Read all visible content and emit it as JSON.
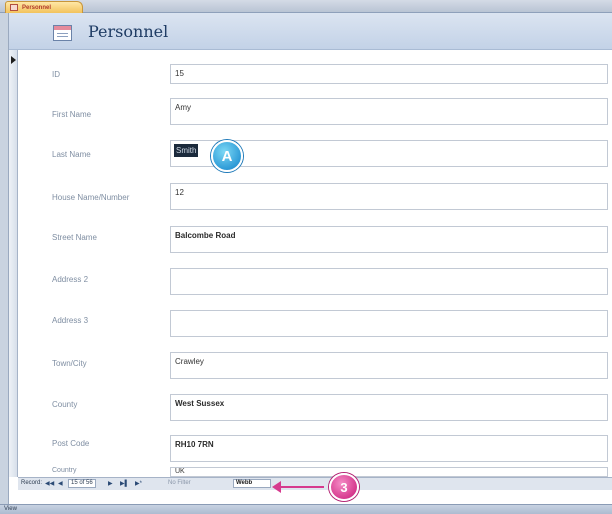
{
  "tab": {
    "label": "Personnel",
    "icon": "form-icon"
  },
  "form": {
    "title": "Personnel",
    "icon": "form-icon"
  },
  "fields": {
    "id": {
      "label": "ID",
      "value": "15"
    },
    "first_name": {
      "label": "First Name",
      "value": "Amy"
    },
    "last_name": {
      "label": "Last Name",
      "value": "Smith"
    },
    "house": {
      "label": "House Name/Number",
      "value": "12"
    },
    "street": {
      "label": "Street Name",
      "value": "Balcombe Road"
    },
    "address2": {
      "label": "Address 2",
      "value": ""
    },
    "address3": {
      "label": "Address 3",
      "value": ""
    },
    "town": {
      "label": "Town/City",
      "value": "Crawley"
    },
    "county": {
      "label": "County",
      "value": "West Sussex"
    },
    "postcode": {
      "label": "Post Code",
      "value": "RH10 7RN"
    },
    "country": {
      "label": "Country",
      "value": "UK"
    }
  },
  "callouts": {
    "a": "A",
    "three": "3"
  },
  "record_nav": {
    "label": "Record:",
    "first": "◀◀",
    "prev": "◀",
    "position": "15 of 56",
    "next": "▶",
    "last": "▶▌",
    "new": "▶*",
    "filter": "No Filter",
    "search": "Webb"
  },
  "status": {
    "text": "View"
  },
  "colors": {
    "callout_a": "#2e9bd7",
    "callout_3": "#d63a8e",
    "header": "#c3d2e7"
  }
}
